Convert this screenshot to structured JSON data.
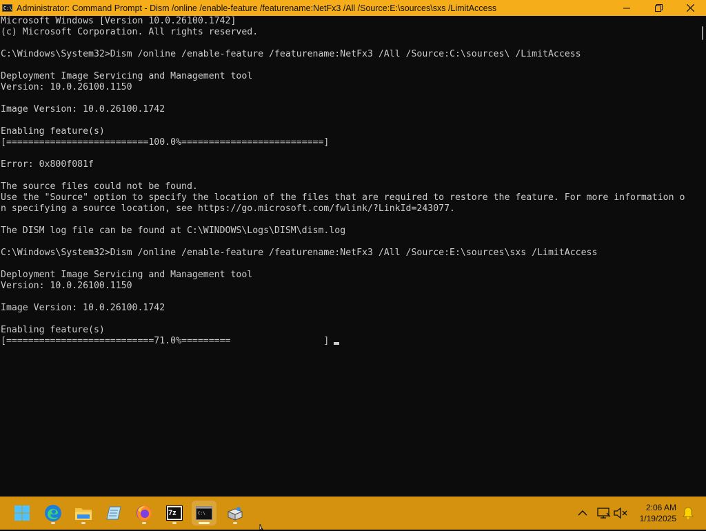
{
  "window": {
    "title": "Administrator: Command Prompt - Dism  /online /enable-feature /featurename:NetFx3 /All /Source:E:\\sources\\sxs /LimitAccess",
    "icon": "cmd-icon",
    "icon_text": "C:\\",
    "controls": [
      "minimize-icon",
      "maximize-icon",
      "close-icon"
    ]
  },
  "console": {
    "lines": [
      "Microsoft Windows [Version 10.0.26100.1742]",
      "(c) Microsoft Corporation. All rights reserved.",
      "",
      "C:\\Windows\\System32>Dism /online /enable-feature /featurename:NetFx3 /All /Source:C:\\sources\\ /LimitAccess",
      "",
      "Deployment Image Servicing and Management tool",
      "Version: 10.0.26100.1150",
      "",
      "Image Version: 10.0.26100.1742",
      "",
      "Enabling feature(s)",
      "[==========================100.0%==========================]",
      "",
      "Error: 0x800f081f",
      "",
      "The source files could not be found.",
      "Use the \"Source\" option to specify the location of the files that are required to restore the feature. For more information o",
      "n specifying a source location, see https://go.microsoft.com/fwlink/?LinkId=243077.",
      "",
      "The DISM log file can be found at C:\\WINDOWS\\Logs\\DISM\\dism.log",
      "",
      "C:\\Windows\\System32>Dism /online /enable-feature /featurename:NetFx3 /All /Source:E:\\sources\\sxs /LimitAccess",
      "",
      "Deployment Image Servicing and Management tool",
      "Version: 10.0.26100.1150",
      "",
      "Image Version: 10.0.26100.1742",
      "",
      "Enabling feature(s)"
    ],
    "progress_text": "[===========================71.0%=========                 ]",
    "progress_value": 71.0
  },
  "taskbar": {
    "apps": [
      {
        "name": "start-button",
        "icon": "windows-start-icon"
      },
      {
        "name": "edge",
        "icon": "edge-icon"
      },
      {
        "name": "file-explorer",
        "icon": "folder-icon"
      },
      {
        "name": "notepad",
        "icon": "notepad-icon"
      },
      {
        "name": "firefox",
        "icon": "firefox-icon"
      },
      {
        "name": "7zip",
        "icon": "7zip-icon",
        "label": "7z"
      },
      {
        "name": "command-prompt",
        "icon": "terminal-icon",
        "active": true
      },
      {
        "name": "installer",
        "icon": "installer-icon"
      }
    ],
    "tray": [
      "chevron-up-icon",
      "network-icon",
      "volume-muted-icon"
    ],
    "time": "2:06 AM",
    "date": "1/19/2025",
    "notification_icon": "bell-icon"
  },
  "colors": {
    "accent": "#f6ad1a",
    "taskbar": "#d4920e",
    "console_bg": "#0c0c0c",
    "console_text": "#cccccc"
  }
}
